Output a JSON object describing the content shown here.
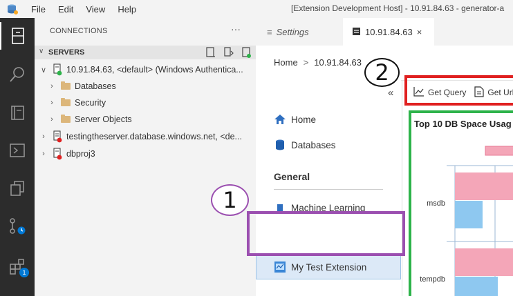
{
  "titlebar": {
    "menu": [
      "File",
      "Edit",
      "View",
      "Help"
    ],
    "window_title": "[Extension Development Host] - 10.91.84.63 - generator-a"
  },
  "activity_bar": {
    "items": [
      "explorer-icon",
      "search-icon",
      "notebooks-icon",
      "terminal-icon",
      "copy-icon",
      "source-control-icon",
      "extensions-icon"
    ],
    "extensions_badge": "1"
  },
  "connections": {
    "header": "CONNECTIONS",
    "more": "···",
    "servers_label": "SERVERS",
    "tree": [
      {
        "label": "10.91.84.63, <default> (Windows Authentica...",
        "expanded": true
      },
      {
        "label": "Databases"
      },
      {
        "label": "Security"
      },
      {
        "label": "Server Objects"
      },
      {
        "label": "testingtheserver.database.windows.net, <de..."
      },
      {
        "label": "dbproj3"
      }
    ]
  },
  "tabs": {
    "settings": "Settings",
    "active": "10.91.84.63",
    "close": "×"
  },
  "breadcrumb": {
    "home": "Home",
    "sep": ">",
    "server": "10.91.84.63"
  },
  "nav": {
    "collapse": "«",
    "home": "Home",
    "databases": "Databases",
    "section_general": "General",
    "machine_learning": "Machine Learning",
    "my_test_extension": "My Test Extension"
  },
  "toolbar": {
    "get_query": "Get Query",
    "get_url": "Get Url"
  },
  "chart_data": {
    "type": "bar",
    "title": "Top 10 DB Space Usag",
    "categories": [
      "msdb",
      "tempdb"
    ],
    "series": [
      {
        "values": [
          100,
          100
        ],
        "color": "#f4a6b8"
      },
      {
        "values": [
          40,
          62
        ],
        "color": "#8ec8f0"
      }
    ],
    "legend_color": "#f4a6b8"
  },
  "annotations": {
    "one": "1",
    "two": "2",
    "purple": "#9b4fb0",
    "red": "#e02020",
    "green": "#2db34a"
  }
}
